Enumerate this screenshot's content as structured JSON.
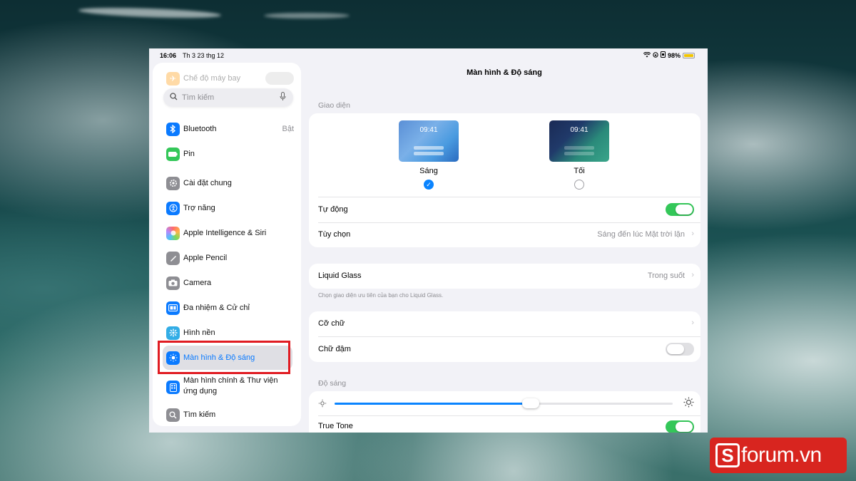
{
  "status": {
    "time": "16:06",
    "date": "Th 3 23 thg 12",
    "battery": "98%"
  },
  "sidebar": {
    "airplane": "Chế độ máy bay",
    "search_placeholder": "Tìm kiếm",
    "items": [
      {
        "label": "Bluetooth",
        "value": "Bật",
        "icon": "bluetooth-icon",
        "color": "#0a7aff"
      },
      {
        "label": "Pin",
        "icon": "battery-icon",
        "color": "#34c759"
      },
      {
        "label": "Cài đặt chung",
        "icon": "gear-icon",
        "color": "#8e8e93"
      },
      {
        "label": "Trợ năng",
        "icon": "accessibility-icon",
        "color": "#0a7aff"
      },
      {
        "label": "Apple Intelligence & Siri",
        "icon": "siri-icon",
        "color": "#e05aa0"
      },
      {
        "label": "Apple Pencil",
        "icon": "pencil-icon",
        "color": "#8e8e93"
      },
      {
        "label": "Camera",
        "icon": "camera-icon",
        "color": "#8e8e93"
      },
      {
        "label": "Đa nhiệm & Cử chỉ",
        "icon": "multitasking-icon",
        "color": "#0a7aff"
      },
      {
        "label": "Hình nền",
        "icon": "wallpaper-icon",
        "color": "#32ade6"
      },
      {
        "label": "Màn hình & Độ sáng",
        "icon": "brightness-icon",
        "color": "#0a7aff"
      },
      {
        "label": "Màn hình chính & Thư viện",
        "label2": "ứng dụng",
        "icon": "homescreen-icon",
        "color": "#0a7aff"
      },
      {
        "label": "Tìm kiếm",
        "icon": "search-icon",
        "color": "#8e8e93"
      }
    ]
  },
  "main": {
    "title": "Màn hình & Độ sáng",
    "appearance_header": "Giao diện",
    "light_time": "09:41",
    "dark_time": "09:41",
    "light_label": "Sáng",
    "dark_label": "Tối",
    "auto_label": "Tự động",
    "options_label": "Tùy chọn",
    "options_value": "Sáng đến lúc Mặt trời lặn",
    "liquid_label": "Liquid Glass",
    "liquid_value": "Trong suốt",
    "liquid_footer": "Chọn giao diện ưu tiên của bạn cho Liquid Glass.",
    "text_size_label": "Cỡ chữ",
    "bold_label": "Chữ đậm",
    "brightness_header": "Độ sáng",
    "brightness_level": 0.58,
    "truetone_label": "True Tone"
  },
  "logo": {
    "letter": "S",
    "text": "forum.vn"
  },
  "colors": {
    "accent": "#0a84ff",
    "toggle_on": "#34c759",
    "highlight": "#e01b22"
  }
}
